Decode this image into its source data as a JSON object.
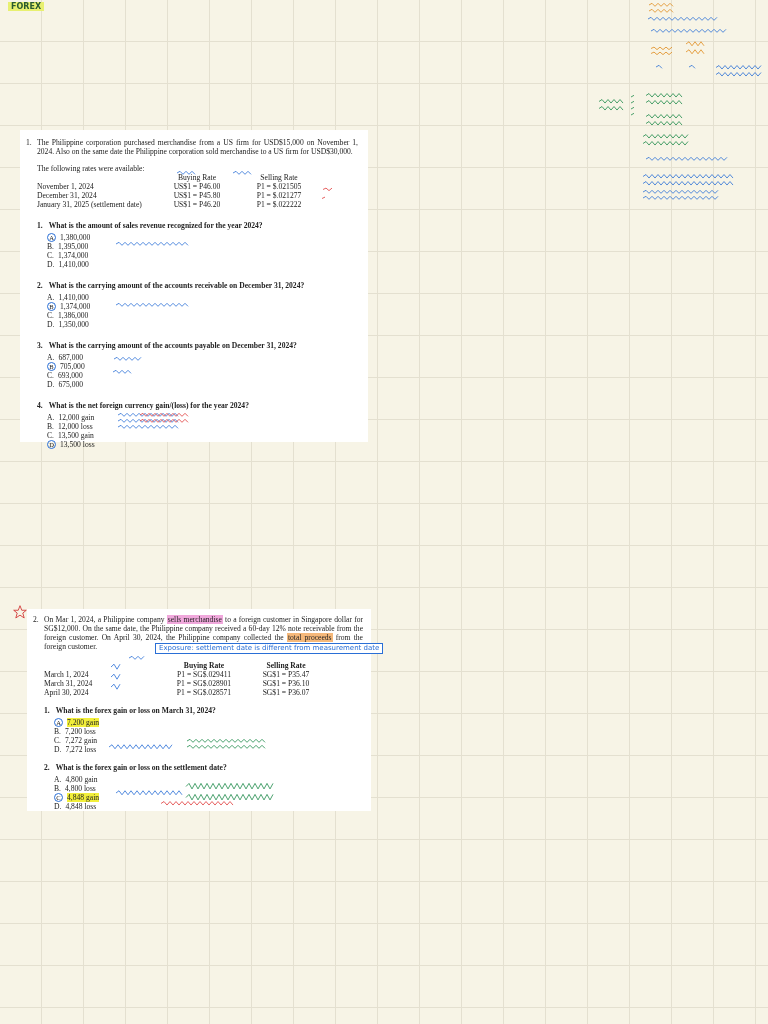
{
  "page_title": "FOREX",
  "problems": [
    {
      "number": "1.",
      "starred": false,
      "text_parts": [
        {
          "text": "The Philippine corporation purchased merchandise from a US firm for USD$15,000 on November 1, 2024. Also on the same date the Philippine corporation sold merchandise to a US firm for USD$30,000."
        }
      ],
      "rates_intro": "The following rates were available:",
      "rate_headers": [
        "Buying Rate",
        "Selling Rate"
      ],
      "rates": [
        {
          "date": "November  1, 2024",
          "buying": "US$1 = P46.00",
          "selling": "P1 = $.021505"
        },
        {
          "date": "December 31, 2024",
          "buying": "US$1 = P45.80",
          "selling": "P1 = $.021277"
        },
        {
          "date": "January 31, 2025 (settlement date)",
          "buying": "US$1 = P46.20",
          "selling": "P1 = $.022222"
        }
      ],
      "questions": [
        {
          "number": "1.",
          "text": "What is the amount of sales revenue recognized for the year 2024?",
          "choices": [
            {
              "letter": "A",
              "text": "1,380,000",
              "selected": true,
              "highlighted": false
            },
            {
              "letter": "B.",
              "text": "1,395,000",
              "selected": false,
              "highlighted": false
            },
            {
              "letter": "C.",
              "text": "1,374,000",
              "selected": false,
              "highlighted": false
            },
            {
              "letter": "D.",
              "text": "1,410,000",
              "selected": false,
              "highlighted": false
            }
          ]
        },
        {
          "number": "2.",
          "text": "What is the carrying amount of the accounts receivable on December 31, 2024?",
          "choices": [
            {
              "letter": "A.",
              "text": "1,410,000",
              "selected": false,
              "highlighted": false
            },
            {
              "letter": "B",
              "text": "1,374,000",
              "selected": true,
              "highlighted": false
            },
            {
              "letter": "C.",
              "text": "1,386,000",
              "selected": false,
              "highlighted": false
            },
            {
              "letter": "D.",
              "text": "1,350,000",
              "selected": false,
              "highlighted": false
            }
          ]
        },
        {
          "number": "3.",
          "text": "What is the carrying amount of the accounts payable on December 31, 2024?",
          "choices": [
            {
              "letter": "A.",
              "text": "687,000",
              "selected": false,
              "highlighted": false
            },
            {
              "letter": "B",
              "text": "705,000",
              "selected": true,
              "highlighted": false
            },
            {
              "letter": "C.",
              "text": "693,000",
              "selected": false,
              "highlighted": false
            },
            {
              "letter": "D.",
              "text": "675,000",
              "selected": false,
              "highlighted": false
            }
          ]
        },
        {
          "number": "4.",
          "text": "What is the net foreign currency gain/(loss) for the year 2024?",
          "choices": [
            {
              "letter": "A.",
              "text": "12,000 gain",
              "selected": false,
              "highlighted": false
            },
            {
              "letter": "B.",
              "text": "12,000 loss",
              "selected": false,
              "highlighted": false
            },
            {
              "letter": "C.",
              "text": "13,500 gain",
              "selected": false,
              "highlighted": false
            },
            {
              "letter": "D",
              "text": "13,500 loss",
              "selected": true,
              "highlighted": false
            }
          ]
        }
      ]
    },
    {
      "number": "2.",
      "starred": true,
      "text_parts": [
        {
          "text": "On Mar 1, 2024, a Philippine company "
        },
        {
          "text": "sells merchandise",
          "color": "#f0a8dc"
        },
        {
          "text": " to a foreign customer in Singapore dollar for SG$12,000. On the same date, the Philippine company received a 60-day 12% note receivable from the foreign customer. On April 30, 2024, the Philippine company collected the "
        },
        {
          "text": "total proceeds",
          "color": "#f5b87a"
        },
        {
          "text": " from the foreign customer."
        }
      ],
      "rate_headers": [
        "Buying Rate",
        "Selling Rate"
      ],
      "rates": [
        {
          "date": "March  1, 2024",
          "buying": "P1 = SG$.029411",
          "selling": "SG$1 = P35.47"
        },
        {
          "date": "March 31, 2024",
          "buying": "P1 = SG$.028901",
          "selling": "SG$1 = P36.10"
        },
        {
          "date": "April  30, 2024",
          "buying": "P1 = SG$.028571",
          "selling": "SG$1 = P36.07"
        }
      ],
      "questions": [
        {
          "number": "1.",
          "text": "What is the forex gain or loss on March 31, 2024?",
          "choices": [
            {
              "letter": "A",
              "text": "7,200 gain",
              "selected": true,
              "highlighted": true
            },
            {
              "letter": "B.",
              "text": "7,200 loss",
              "selected": false,
              "highlighted": false
            },
            {
              "letter": "C.",
              "text": "7,272 gain",
              "selected": false,
              "highlighted": false
            },
            {
              "letter": "D.",
              "text": "7,272 loss",
              "selected": false,
              "highlighted": false
            }
          ]
        },
        {
          "number": "2.",
          "text": "What is the forex gain or loss on the settlement date?",
          "choices": [
            {
              "letter": "A.",
              "text": "4,800 gain",
              "selected": false,
              "highlighted": false
            },
            {
              "letter": "B.",
              "text": "4,800 loss",
              "selected": false,
              "highlighted": false
            },
            {
              "letter": "C",
              "text": "4,848 gain",
              "selected": true,
              "highlighted": true
            },
            {
              "letter": "D.",
              "text": "4,848 loss",
              "selected": false,
              "highlighted": false
            }
          ]
        }
      ]
    }
  ],
  "callout": "Exposure: settlement date is different from measurement date"
}
